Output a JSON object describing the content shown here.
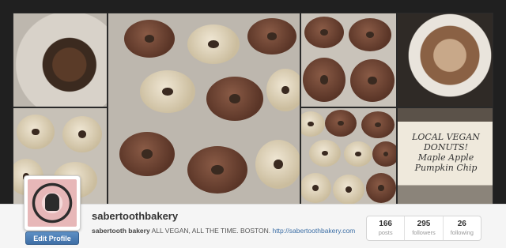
{
  "profile": {
    "username": "sabertoothbakery",
    "bio_name": "sabertooth bakery",
    "bio_text": "ALL VEGAN, ALL THE TIME. BOSTON.",
    "bio_link": "http://sabertoothbakery.com",
    "edit_label": "Edit Profile"
  },
  "stats": [
    {
      "value": "166",
      "label": "posts"
    },
    {
      "value": "295",
      "label": "followers"
    },
    {
      "value": "26",
      "label": "following"
    }
  ],
  "banner": {
    "sign_text": "LOCAL VEGAN DONUTS! Maple Apple Pumpkin Chip"
  },
  "colors": {
    "link": "#3b6ea5",
    "button": "#4a7db4"
  }
}
